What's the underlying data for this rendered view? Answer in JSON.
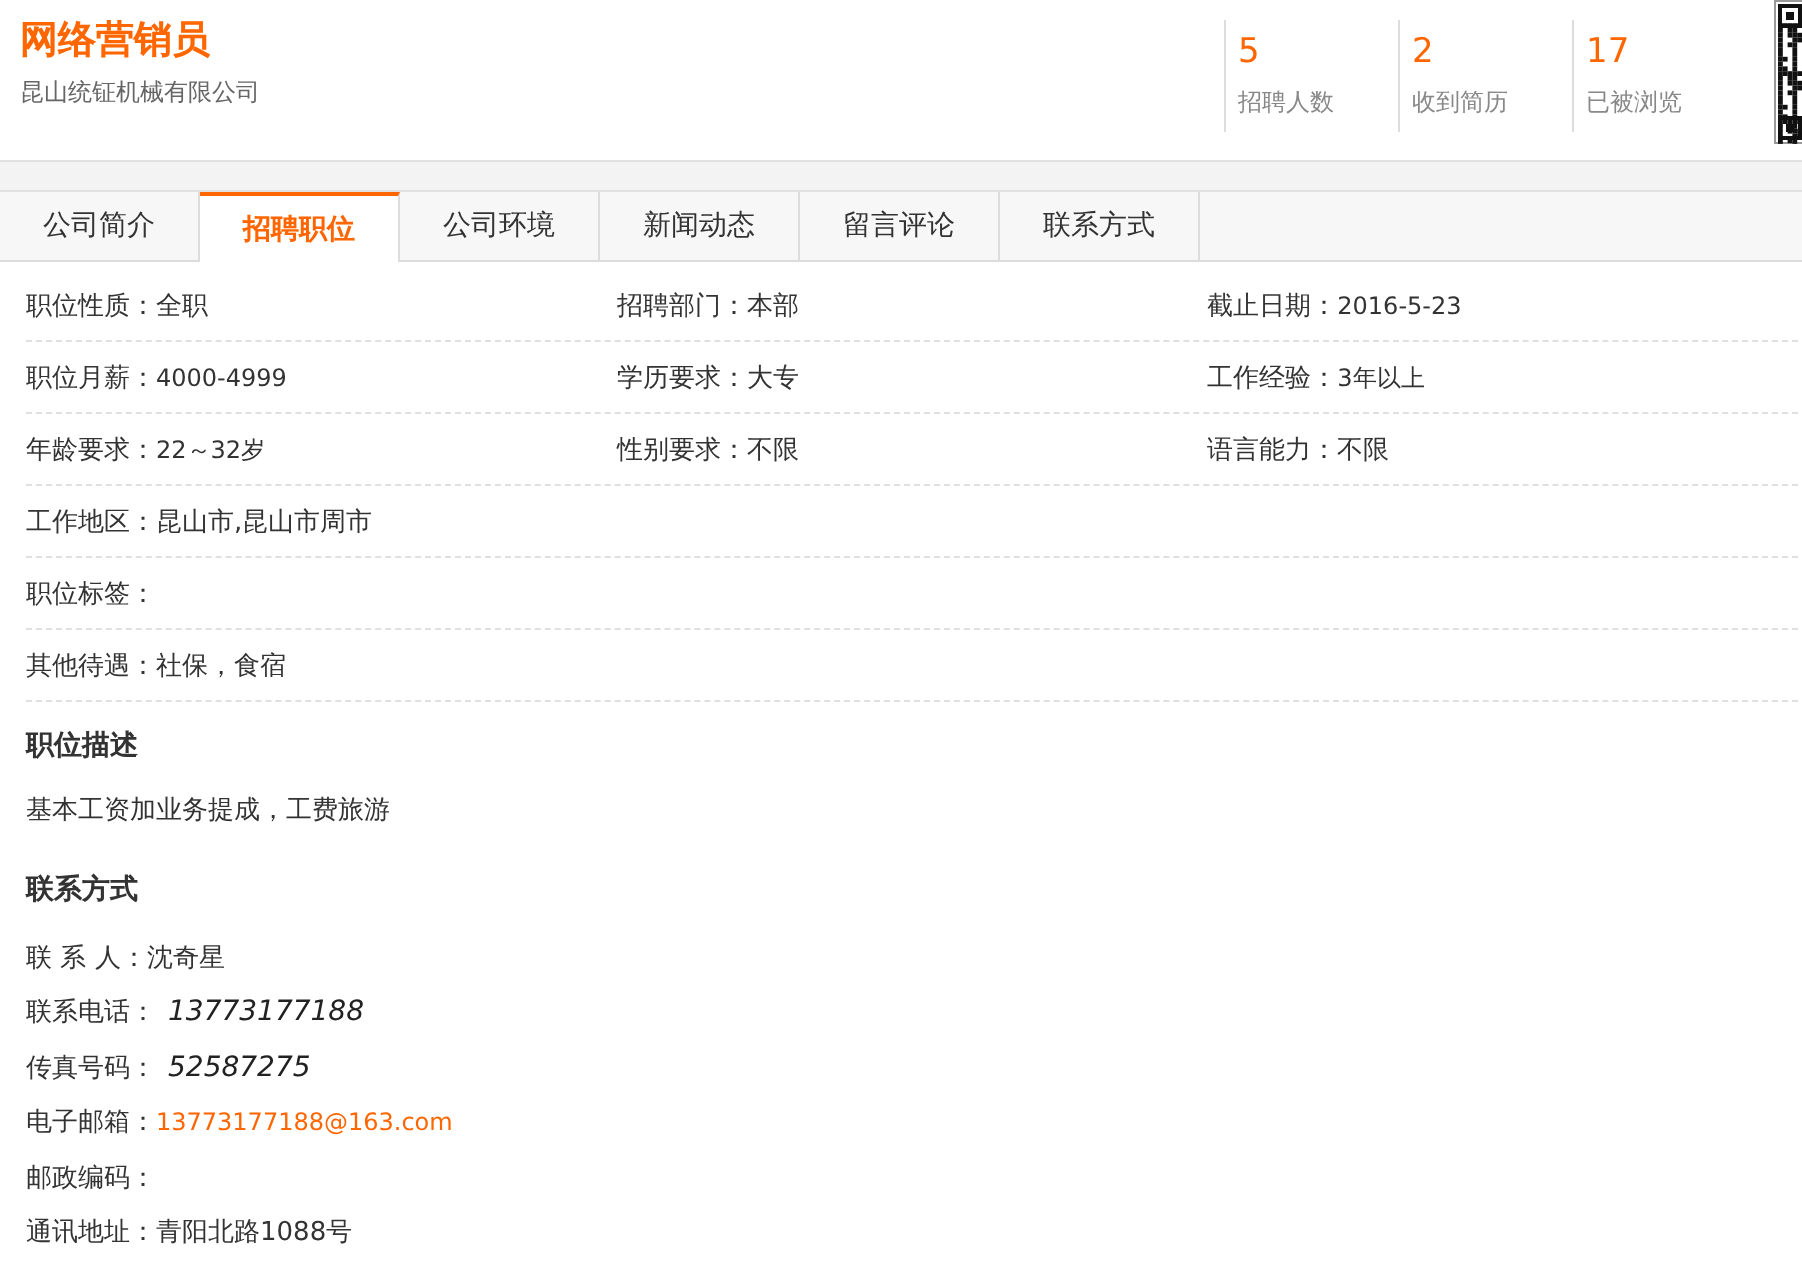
{
  "header": {
    "title": "网络营销员",
    "company": "昆山统钲机械有限公司",
    "stats": [
      {
        "value": "5",
        "label": "招聘人数"
      },
      {
        "value": "2",
        "label": "收到简历"
      },
      {
        "value": "17",
        "label": "已被浏览"
      }
    ]
  },
  "tabs": [
    {
      "label": "公司简介",
      "selected": false
    },
    {
      "label": "招聘职位",
      "selected": true
    },
    {
      "label": "公司环境",
      "selected": false
    },
    {
      "label": "新闻动态",
      "selected": false
    },
    {
      "label": "留言评论",
      "selected": false
    },
    {
      "label": "联系方式",
      "selected": false
    }
  ],
  "field_rows": [
    [
      {
        "label": "职位性质：",
        "value": "全职"
      },
      {
        "label": "招聘部门：",
        "value": "本部"
      },
      {
        "label": "截止日期：",
        "value": "2016-5-23"
      }
    ],
    [
      {
        "label": "职位月薪：",
        "value": "4000-4999"
      },
      {
        "label": "学历要求：",
        "value": "大专"
      },
      {
        "label": "工作经验：",
        "value": "3年以上"
      }
    ],
    [
      {
        "label": "年龄要求：",
        "value": "22～32岁"
      },
      {
        "label": "性别要求：",
        "value": "不限"
      },
      {
        "label": "语言能力：",
        "value": "不限"
      }
    ],
    [
      {
        "label": "工作地区：",
        "value": "昆山市,昆山市周市"
      }
    ],
    [
      {
        "label": "职位标签："
      }
    ],
    [
      {
        "label": "其他待遇：",
        "value": "社保，食宿"
      }
    ]
  ],
  "description": {
    "heading": "职位描述",
    "text": "基本工资加业务提成，工费旅游"
  },
  "contact": {
    "heading": "联系方式",
    "items": [
      {
        "label": "联 系 人：",
        "value": "沈奇星",
        "kind": "text"
      },
      {
        "label": "联系电话：",
        "value": "13773177188",
        "kind": "image"
      },
      {
        "label": "传真号码：",
        "value": "52587275",
        "kind": "image"
      },
      {
        "label": "电子邮箱：",
        "value": "13773177188@163.com",
        "kind": "link"
      },
      {
        "label": "邮政编码："
      },
      {
        "label": "通讯地址：",
        "value": "青阳北路1088号",
        "kind": "text"
      }
    ]
  }
}
